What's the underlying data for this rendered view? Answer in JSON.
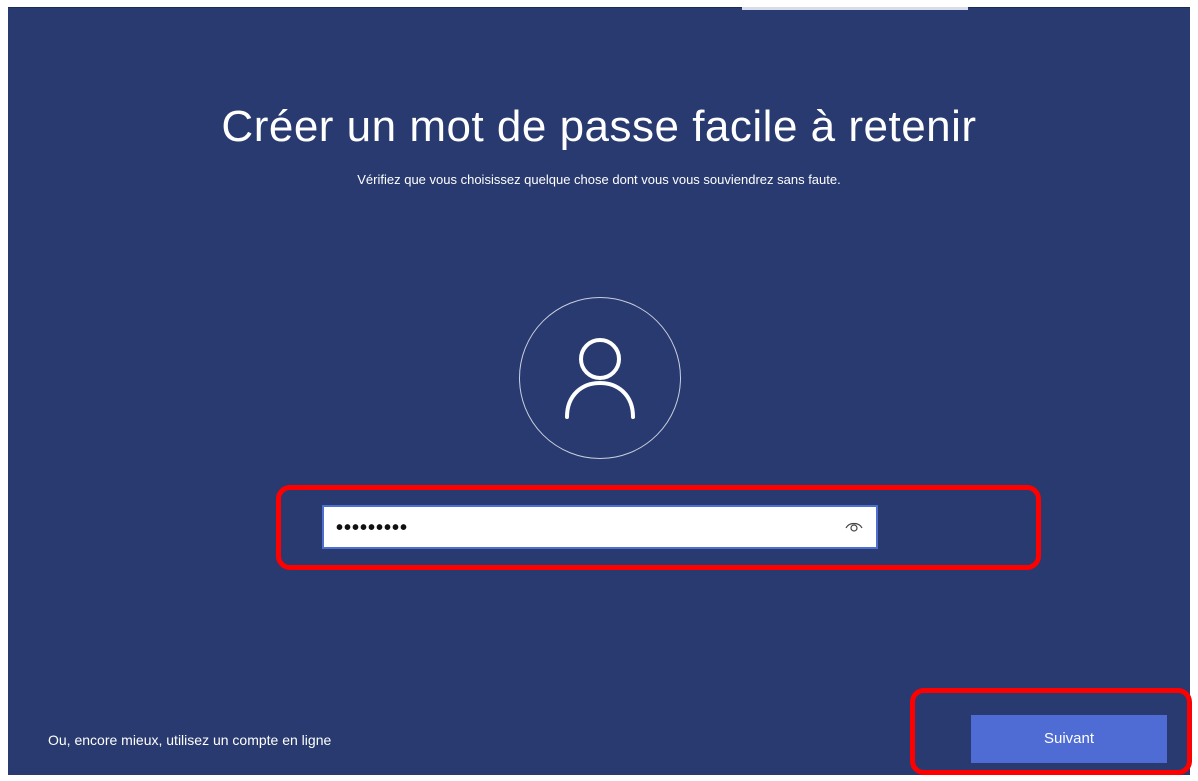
{
  "header": {
    "title": "Créer un mot de passe facile à retenir",
    "subtitle": "Vérifiez que vous choisissez quelque chose dont vous vous souviendrez sans faute."
  },
  "avatar": {
    "icon": "user-icon"
  },
  "password": {
    "masked_value": "•••••••••",
    "reveal_icon": "eye-icon"
  },
  "footer": {
    "online_account_link": "Ou, encore mieux, utilisez un compte en ligne",
    "next_label": "Suivant"
  },
  "colors": {
    "background": "#283a6f",
    "accent": "#4e6cd3",
    "annotation": "#ff0000"
  }
}
